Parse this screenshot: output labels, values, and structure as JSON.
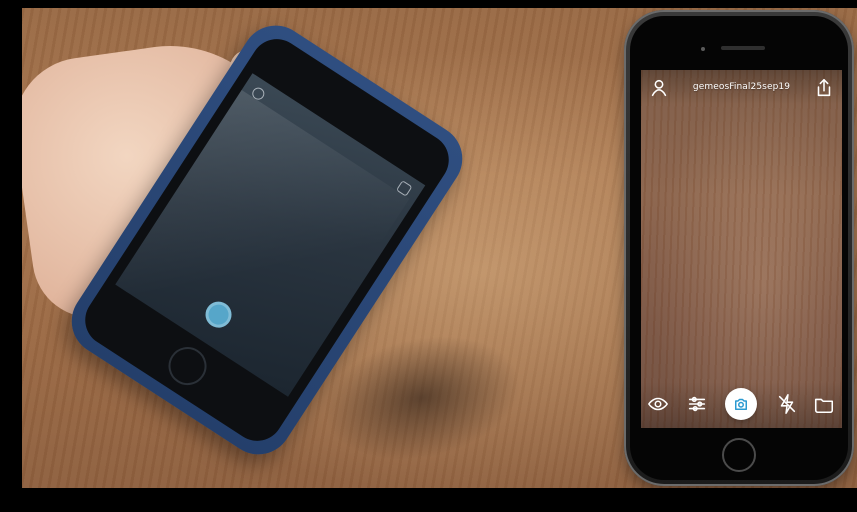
{
  "mock_app": {
    "title": "gemeosFinal25sep19",
    "icons": {
      "top_left": "user-icon",
      "top_right": "share-icon",
      "bottom": [
        "eye-icon",
        "sliders-icon",
        "camera-icon",
        "flash-off-icon",
        "folder-icon"
      ]
    }
  },
  "colors": {
    "accent": "#2b9ad1",
    "video_bg": "#000000"
  }
}
